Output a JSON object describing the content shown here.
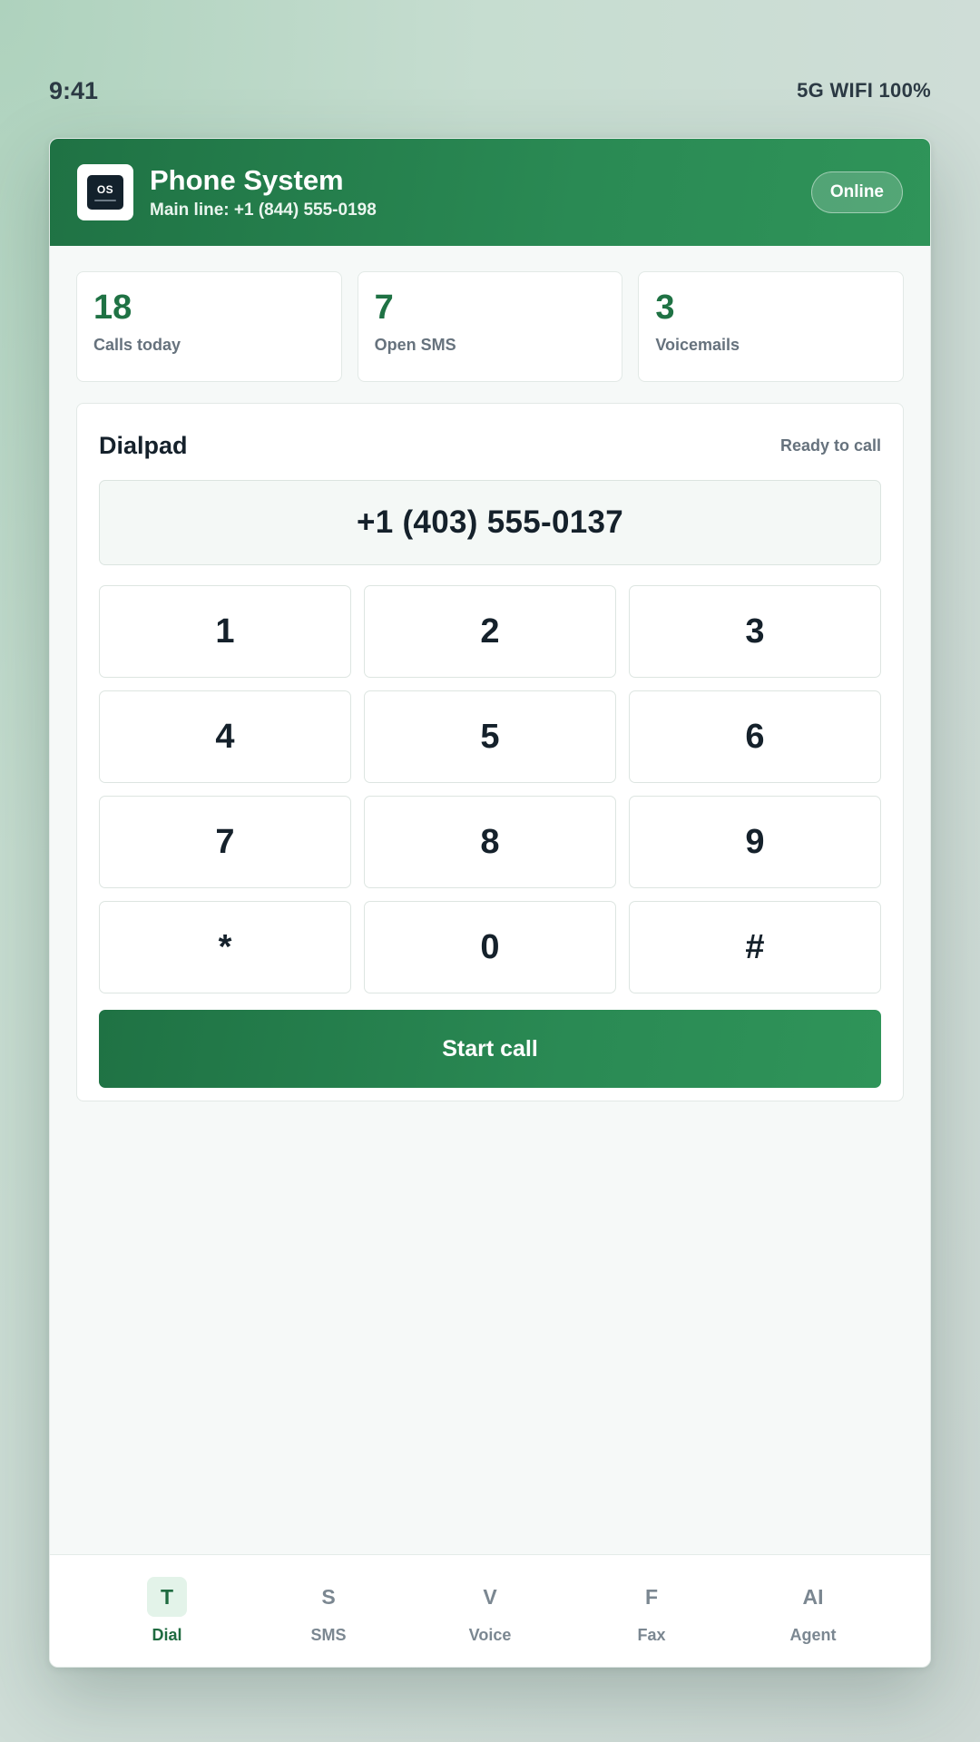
{
  "status_bar": {
    "time": "9:41",
    "indicators": "5G WIFI 100%"
  },
  "header": {
    "logo_text": "OS",
    "title": "Phone System",
    "subtitle": "Main line: +1 (844) 555-0198",
    "status": "Online"
  },
  "stats": [
    {
      "value": "18",
      "label": "Calls today"
    },
    {
      "value": "7",
      "label": "Open SMS"
    },
    {
      "value": "3",
      "label": "Voicemails"
    }
  ],
  "dialpad": {
    "title": "Dialpad",
    "status": "Ready to call",
    "number": "+1 (403) 555-0137",
    "keys": [
      "1",
      "2",
      "3",
      "4",
      "5",
      "6",
      "7",
      "8",
      "9",
      "*",
      "0",
      "#"
    ],
    "call_label": "Start call"
  },
  "tabs": [
    {
      "icon": "T",
      "label": "Dial",
      "active": true
    },
    {
      "icon": "S",
      "label": "SMS",
      "active": false
    },
    {
      "icon": "V",
      "label": "Voice",
      "active": false
    },
    {
      "icon": "F",
      "label": "Fax",
      "active": false
    },
    {
      "icon": "AI",
      "label": "Agent",
      "active": false
    }
  ],
  "colors": {
    "brand": "#1f7244",
    "text": "#15212b",
    "muted": "#66727d"
  }
}
